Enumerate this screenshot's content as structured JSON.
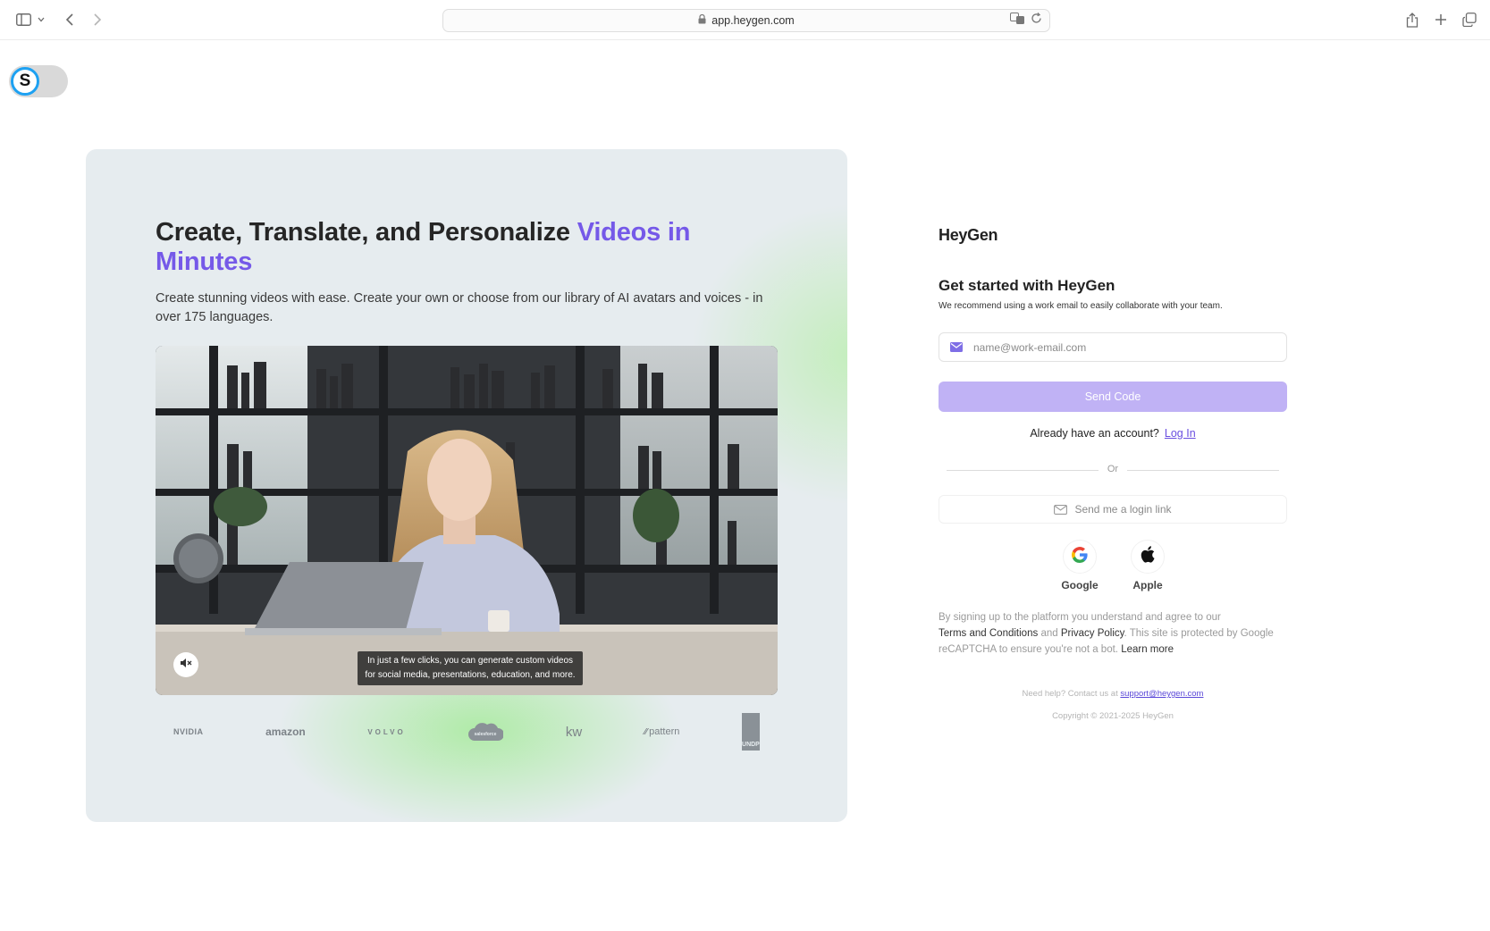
{
  "browser": {
    "url": "app.heygen.com",
    "icons": [
      "sidebar-icon",
      "chevron-down-icon",
      "back-icon",
      "forward-icon",
      "lock-icon",
      "translate-icon",
      "reload-icon",
      "share-icon",
      "new-tab-icon",
      "tabs-overview-icon"
    ]
  },
  "extension": {
    "letter": "S"
  },
  "hero": {
    "title_main": "Create, Translate, and Personalize ",
    "title_accent": "Videos in Minutes",
    "subtitle": "Create stunning videos with ease. Create your own or choose from our library of AI avatars and voices - in over 175 languages.",
    "video_caption_line1": "In just a few clicks, you can generate custom videos",
    "video_caption_line2": "for social media, presentations, education, and more.",
    "logos": [
      "NVIDIA",
      "amazon",
      "VOLVO",
      "salesforce",
      "kw",
      "pattern",
      "UNDP"
    ]
  },
  "signup": {
    "brand": "HeyGen",
    "title": "Get started with HeyGen",
    "subtitle": "We recommend using a work email to easily collaborate with your team.",
    "email_placeholder": "name@work-email.com",
    "email_value": "",
    "send_code_label": "Send Code",
    "have_account_text": "Already have an account?",
    "login_link": "Log In",
    "divider_text": "Or",
    "login_link_button": "Send me a login link",
    "social": [
      {
        "label": "Google",
        "icon": "google-icon"
      },
      {
        "label": "Apple",
        "icon": "apple-icon"
      }
    ],
    "legal": {
      "part1": "By signing up to the platform you understand and agree to our",
      "terms": "Terms and Conditions",
      "and": "and",
      "privacy": "Privacy Policy",
      "part2": ". This site is protected by Google reCAPTCHA to ensure you're not a bot.",
      "learn_more": "Learn more"
    },
    "help_text": "Need help? Contact us at",
    "help_email": "support@heygen.com",
    "copyright": "Copyright © 2021-2025 HeyGen"
  },
  "colors": {
    "accent": "#7559e8",
    "send_button": "#c0b2f5",
    "link": "#6a4fe0",
    "hero_bg": "#e6ecef",
    "hero_glow": "#b4ea9f"
  }
}
